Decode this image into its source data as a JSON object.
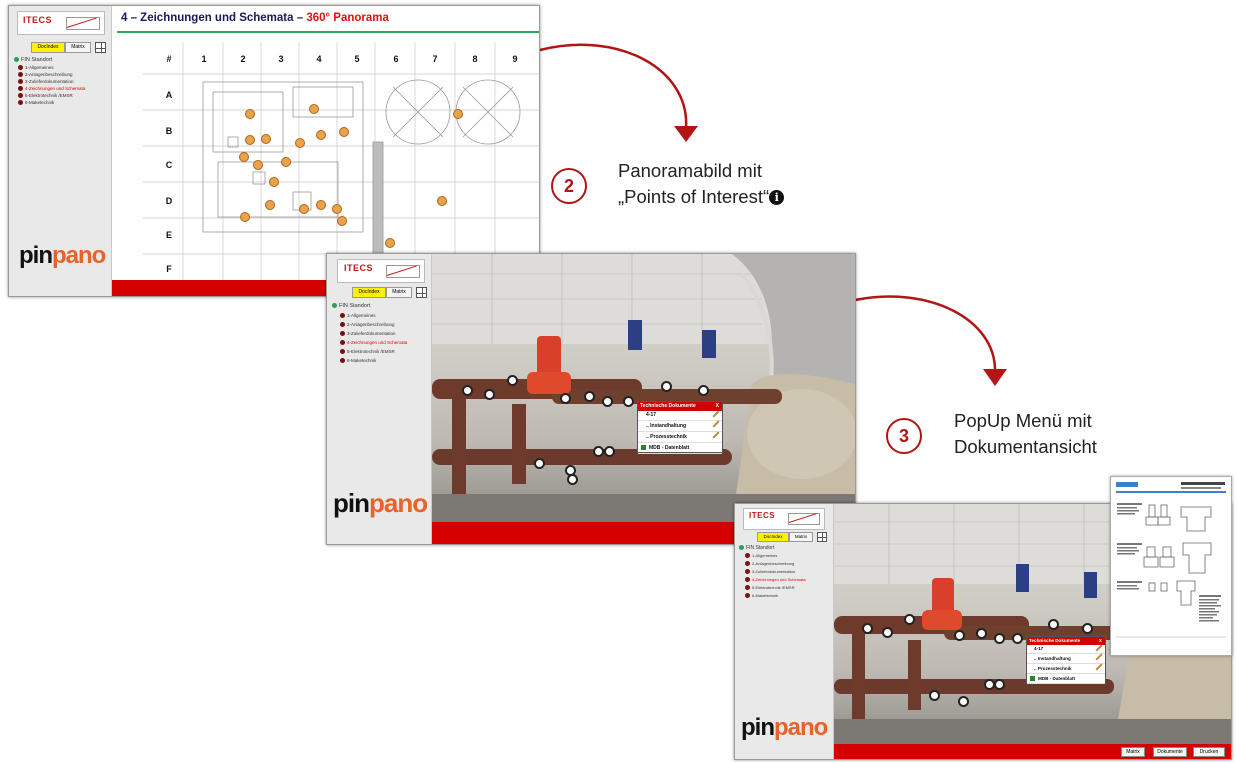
{
  "screen1": {
    "title_main": "4 – Zeichnungen und Schemata – ",
    "title_highlight": "360° Panorama",
    "grid_cols": [
      "#",
      "1",
      "2",
      "3",
      "4",
      "5",
      "6",
      "7",
      "8",
      "9"
    ],
    "grid_rows": [
      "A",
      "B",
      "C",
      "D",
      "E",
      "F"
    ]
  },
  "sidebar": {
    "brand": "ITECS",
    "brand_sub": "",
    "tab_docindex": "DocIndex",
    "tab_matrix": "Matrix",
    "tree_root": "FIN Standort",
    "tree_items": [
      "1-Allgemeines",
      "2-Anlagenbeschreibung",
      "3-Zulieferdokumentation",
      "4-Zeichnungen und Schemata",
      "5-Elektrotechnik /EMSR",
      "6-Maketechnik"
    ],
    "logo_pin": "pin",
    "logo_pano": "pano"
  },
  "popup": {
    "header": "Technische Dokumente",
    "close": "X",
    "item_id": "4-17",
    "item_1": ".. Instandhaltung",
    "item_2": ".. Prozesstechnik",
    "item_3": "MDB - Datenblatt"
  },
  "buttons": {
    "matrix": "Matrix",
    "dokumente": "Dokumente",
    "drucken": "Drucken"
  },
  "steps": {
    "step2_number": "2",
    "step2_line1": "Panoramabild mit",
    "step2_line2": "„Points of Interest“",
    "step3_number": "3",
    "step3_line1": "PopUp Menü mit",
    "step3_line2": "Dokumentansicht"
  },
  "colors": {
    "accent_red": "#d40000",
    "arrow_red": "#b31414",
    "title_green": "#2fa85b",
    "tab_yellow": "#fff200",
    "poi_orange": "#e8a44a"
  }
}
